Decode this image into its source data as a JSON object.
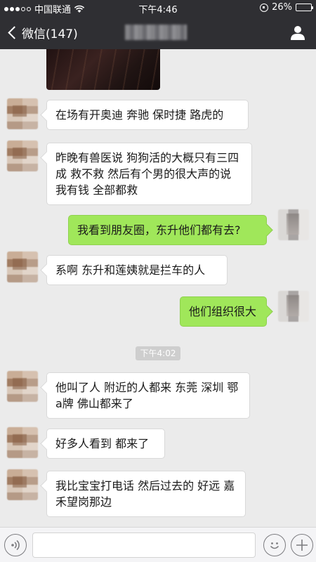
{
  "status_bar": {
    "carrier": "中国联通",
    "time": "下午4:46",
    "battery": "26%",
    "battery_level": 0.26
  },
  "nav": {
    "back_label": "微信(147)"
  },
  "messages": [
    {
      "side": "left",
      "text": "在场有开奥迪 奔驰 保时捷 路虎的"
    },
    {
      "side": "left",
      "text": "昨晚有兽医说 狗狗活的大概只有三四成 救不救 然后有个男的很大声的说 我有钱 全部都救"
    },
    {
      "side": "right",
      "text": "我看到朋友圈，东升他们都有去?"
    },
    {
      "side": "left",
      "text": "系啊 东升和莲姨就是拦车的人"
    },
    {
      "side": "right",
      "text": "他们组织很大"
    },
    {
      "side": "left",
      "text": "他叫了人 附近的人都来 东莞 深圳 鄂a牌 佛山都来了"
    },
    {
      "side": "left",
      "text": "好多人看到 都来了"
    },
    {
      "side": "left",
      "text": "我比宝宝打电话 然后过去的 好远 嘉禾望岗那边"
    }
  ],
  "time_divider": "下午4:02",
  "icons": {
    "wifi": "wifi-icon",
    "battery": "battery-icon",
    "profile": "profile-icon",
    "voice": "voice-icon",
    "emoji": "emoji-icon",
    "plus": "plus-icon"
  },
  "colors": {
    "nav_bg": "#2f2f33",
    "chat_bg": "#ebebeb",
    "bubble_self": "#a0e75a",
    "bubble_other": "#ffffff"
  }
}
